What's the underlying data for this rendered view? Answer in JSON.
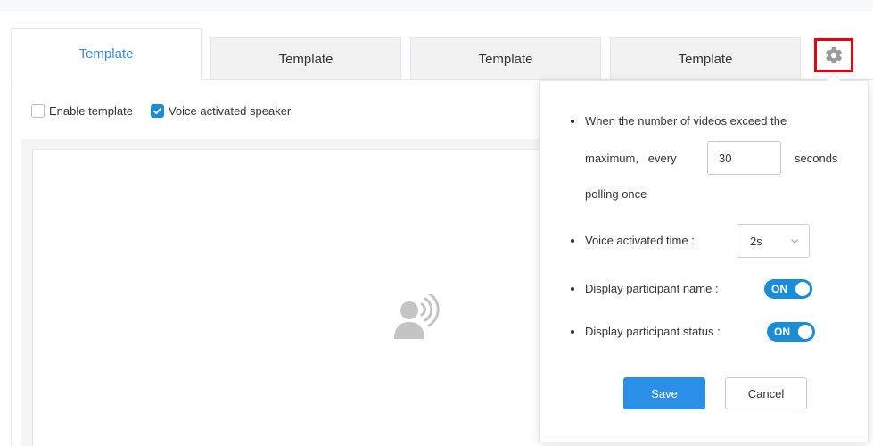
{
  "tabs": [
    {
      "label": "Template",
      "active": true
    },
    {
      "label": "Template",
      "active": false
    },
    {
      "label": "Template",
      "active": false
    },
    {
      "label": "Template",
      "active": false
    }
  ],
  "options": {
    "enable_template": {
      "label": "Enable template",
      "checked": false
    },
    "voice_activated_speaker": {
      "label": "Voice activated speaker",
      "checked": true
    }
  },
  "settings": {
    "polling": {
      "line1": "When the number of videos exceed the",
      "prefix": "maximum,   every",
      "value": "30",
      "suffix": "seconds",
      "line3": "polling once"
    },
    "voice_time": {
      "label": "Voice activated time :",
      "value": "2s"
    },
    "display_name": {
      "label": "Display participant name :",
      "state": "ON"
    },
    "display_status": {
      "label": "Display participant status :",
      "state": "ON"
    },
    "save_label": "Save",
    "cancel_label": "Cancel"
  },
  "colors": {
    "accent": "#1a8cd8",
    "primary_button": "#2b8fe8",
    "active_tab_text": "#3b8bd6",
    "highlight_border": "#e60012"
  },
  "icons": {
    "settings": "gear-icon",
    "placeholder": "voice-speaker-icon"
  }
}
